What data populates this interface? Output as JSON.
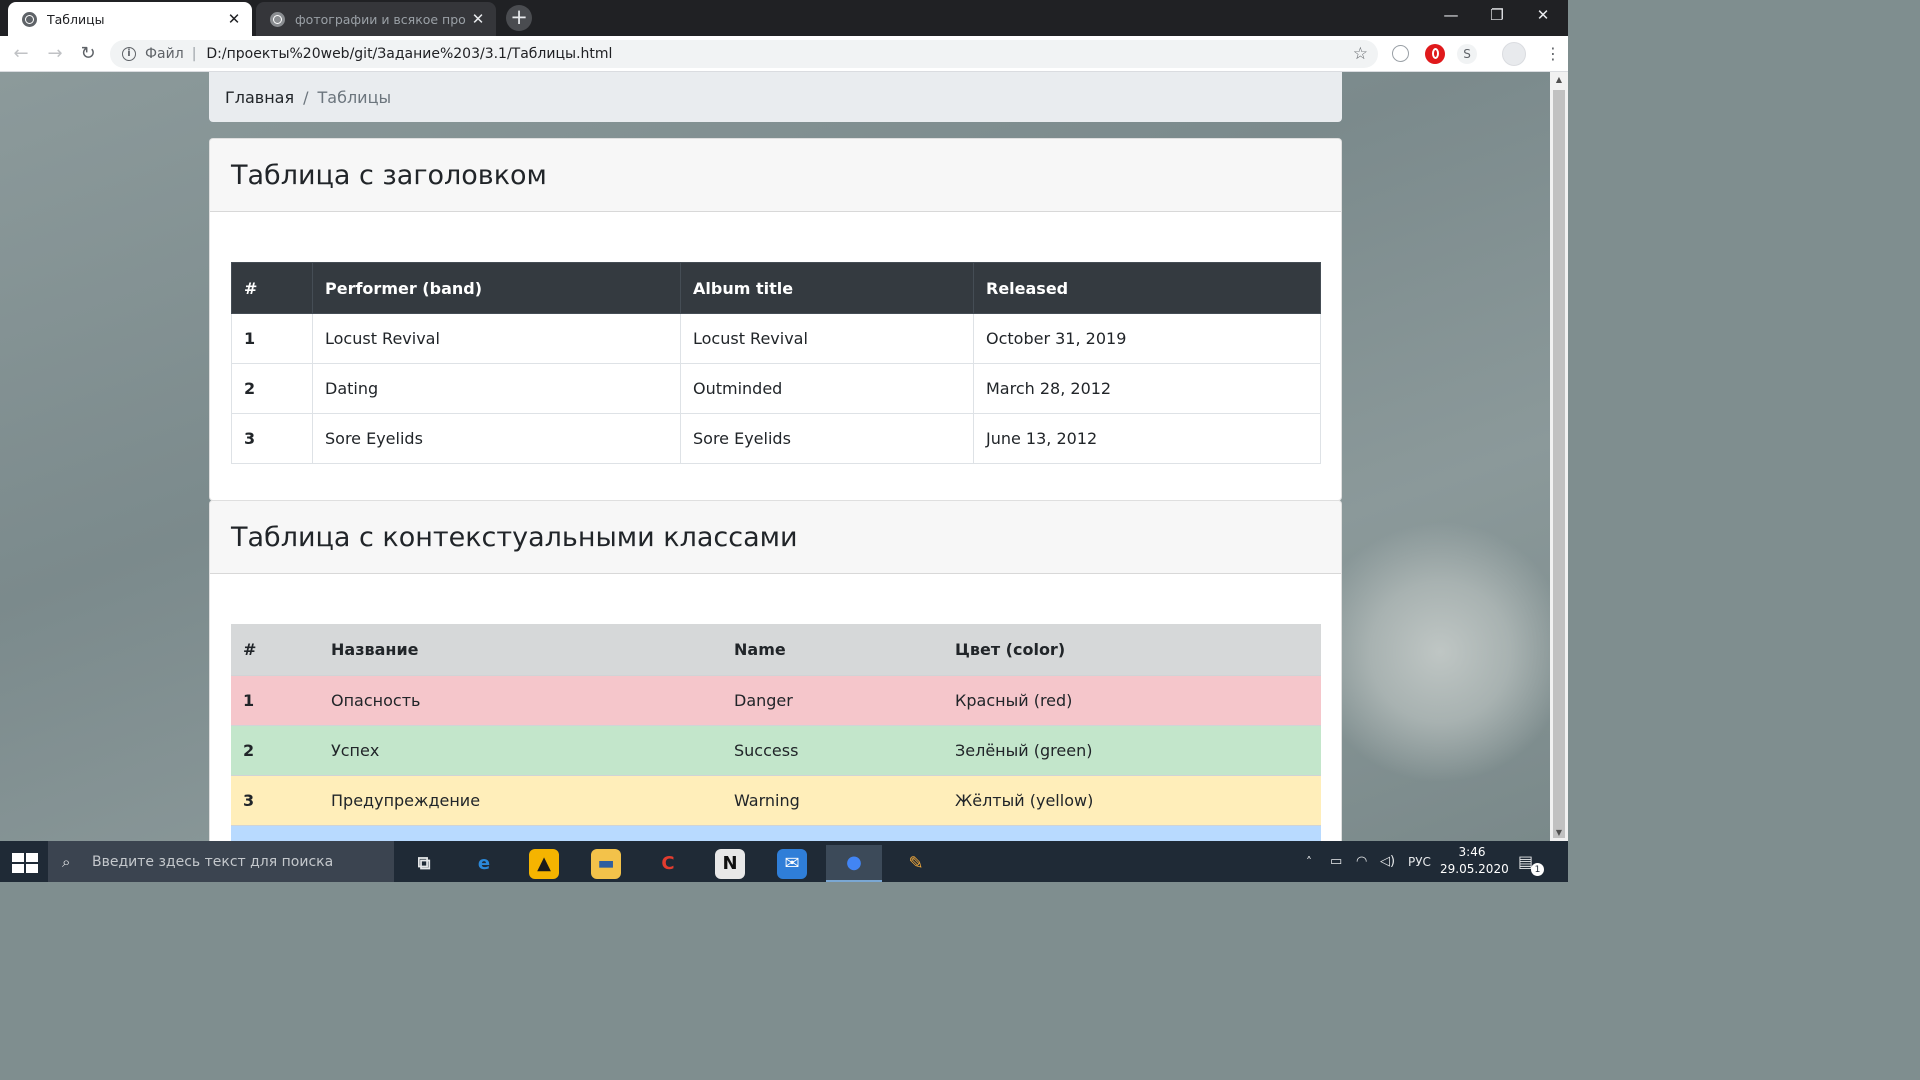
{
  "browser": {
    "tabs": [
      {
        "title": "Таблицы",
        "active": true
      },
      {
        "title": "фотографии и всякое про плён",
        "active": false
      }
    ],
    "new_tab_label": "+",
    "address": {
      "scheme_label": "Файл",
      "separator": "|",
      "url": "D:/проекты%20web/git/Задание%203/3.1/Таблицы.html"
    },
    "extensions": [
      {
        "name": "globe-icon",
        "label": "",
        "color": "#5f6368"
      },
      {
        "name": "opera-icon",
        "label": "",
        "color": "#e0191b"
      },
      {
        "name": "s-extension-icon",
        "label": "S",
        "color": "#5f6368"
      },
      {
        "name": "profile-avatar",
        "label": "",
        "color": "#e8eaed"
      }
    ]
  },
  "page": {
    "breadcrumb": {
      "home": "Главная",
      "separator": "/",
      "current": "Таблицы"
    },
    "table1": {
      "heading": "Таблица с заголовком",
      "columns": [
        "#",
        "Performer (band)",
        "Album title",
        "Released"
      ],
      "rows": [
        [
          "1",
          "Locust Revival",
          "Locust Revival",
          "October 31, 2019"
        ],
        [
          "2",
          "Dating",
          "Outminded",
          "March 28, 2012"
        ],
        [
          "3",
          "Sore Eyelids",
          "Sore Eyelids",
          "June 13, 2012"
        ]
      ]
    },
    "table2": {
      "heading": "Таблица с контекстуальными классами",
      "columns": [
        "#",
        "Название",
        "Name",
        "Цвет (color)"
      ],
      "rows": [
        {
          "cells": [
            "1",
            "Опасность",
            "Danger",
            "Красный (red)"
          ],
          "color": "#f5c6cb"
        },
        {
          "cells": [
            "2",
            "Успех",
            "Success",
            "Зелёный (green)"
          ],
          "color": "#c3e6cb"
        },
        {
          "cells": [
            "3",
            "Предупреждение",
            "Warning",
            "Жёлтый (yellow)"
          ],
          "color": "#ffeeba"
        },
        {
          "cells": [
            "",
            "",
            "",
            ""
          ],
          "color": "#b8daff"
        }
      ]
    }
  },
  "taskbar": {
    "search_placeholder": "Введите здесь текст для поиска",
    "apps": [
      {
        "name": "task-view-icon",
        "glyph": "⧉",
        "bg": "transparent",
        "fg": "#e6e8ea"
      },
      {
        "name": "edge-icon",
        "glyph": "e",
        "bg": "transparent",
        "fg": "#2b88d8"
      },
      {
        "name": "aimp-icon",
        "glyph": "▲",
        "bg": "#f5b400",
        "fg": "#1a1a1a"
      },
      {
        "name": "file-explorer-icon",
        "glyph": "▬",
        "bg": "#f3c24a",
        "fg": "#2f5fa0"
      },
      {
        "name": "ccleaner-icon",
        "glyph": "C",
        "bg": "transparent",
        "fg": "#e23c2f"
      },
      {
        "name": "notion-icon",
        "glyph": "N",
        "bg": "#e8e8e8",
        "fg": "#111111"
      },
      {
        "name": "mail-icon",
        "glyph": "✉",
        "bg": "#2f7ed8",
        "fg": "#ffffff"
      },
      {
        "name": "chrome-icon",
        "glyph": "●",
        "bg": "transparent",
        "fg": "#4285f4"
      },
      {
        "name": "paint-icon",
        "glyph": "✎",
        "bg": "transparent",
        "fg": "#f2a93b"
      }
    ],
    "active_app": "chrome-icon",
    "language": "РУС",
    "time": "3:46",
    "date": "29.05.2020",
    "notification_count": "1"
  }
}
